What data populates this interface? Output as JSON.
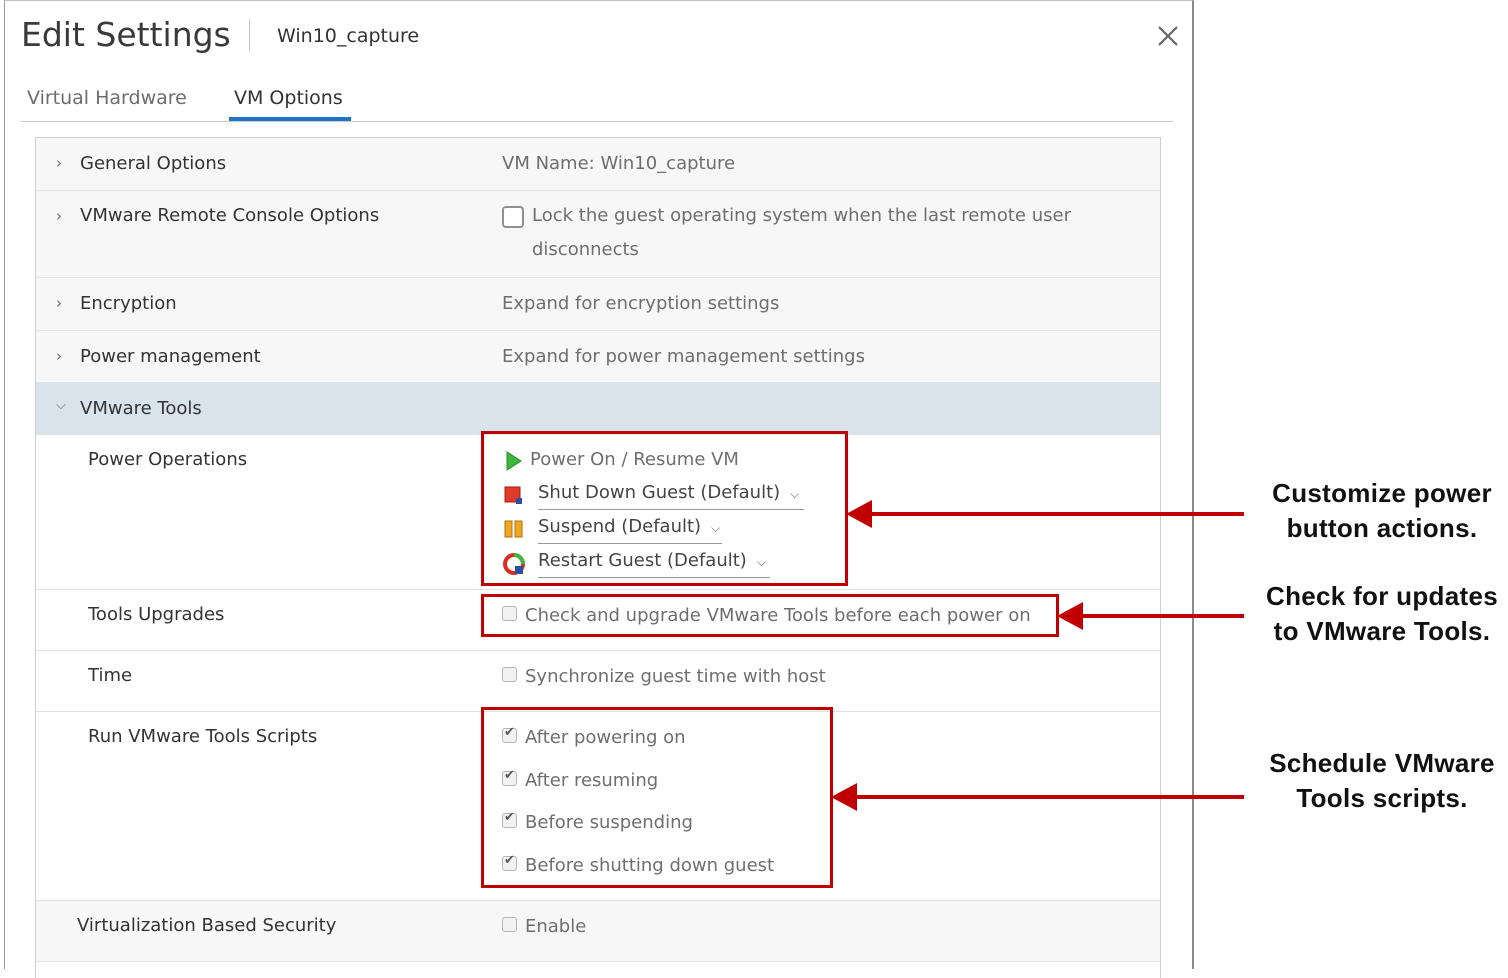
{
  "dialog": {
    "title": "Edit Settings",
    "subtitle": "Win10_capture",
    "close_icon": "close-icon",
    "tabs": [
      {
        "label": "Virtual Hardware",
        "active": false
      },
      {
        "label": "VM Options",
        "active": true
      }
    ]
  },
  "sections": {
    "general": {
      "label": "General Options",
      "value": "VM Name: Win10_capture"
    },
    "remote_console": {
      "label": "VMware Remote Console Options",
      "checkbox_line1": "Lock the guest operating system when the last remote user",
      "checkbox_line2": "disconnects",
      "checked": false
    },
    "encryption": {
      "label": "Encryption",
      "value": "Expand for encryption settings"
    },
    "power_mgmt": {
      "label": "Power management",
      "value": "Expand for power management settings"
    },
    "vmware_tools": {
      "label": "VMware Tools"
    },
    "virt_security": {
      "label": "Virtualization Based Security",
      "checkbox": "Enable",
      "checked": false
    }
  },
  "tools": {
    "power_operations": {
      "label": "Power Operations",
      "power_on": "Power On / Resume VM",
      "shut_down": "Shut Down Guest (Default)",
      "suspend": "Suspend (Default)",
      "restart": "Restart Guest (Default)"
    },
    "upgrades": {
      "label": "Tools Upgrades",
      "checkbox": "Check and upgrade VMware Tools before each power on",
      "checked": false
    },
    "time": {
      "label": "Time",
      "checkbox": "Synchronize guest time with host",
      "checked": false
    },
    "scripts": {
      "label": "Run VMware Tools Scripts",
      "items": [
        {
          "label": "After powering on",
          "checked": true
        },
        {
          "label": "After resuming",
          "checked": true
        },
        {
          "label": "Before suspending",
          "checked": true
        },
        {
          "label": "Before shutting down guest",
          "checked": true
        }
      ]
    }
  },
  "callouts": {
    "power": {
      "line1": "Customize power",
      "line2": "button actions."
    },
    "updates": {
      "line1": "Check for updates",
      "line2": "to VMware Tools."
    },
    "scripts": {
      "line1": "Schedule VMware",
      "line2": "Tools scripts."
    }
  },
  "colors": {
    "accent": "#1f75c4",
    "annotation": "#c00000",
    "selected_row": "#d8e3ec"
  }
}
